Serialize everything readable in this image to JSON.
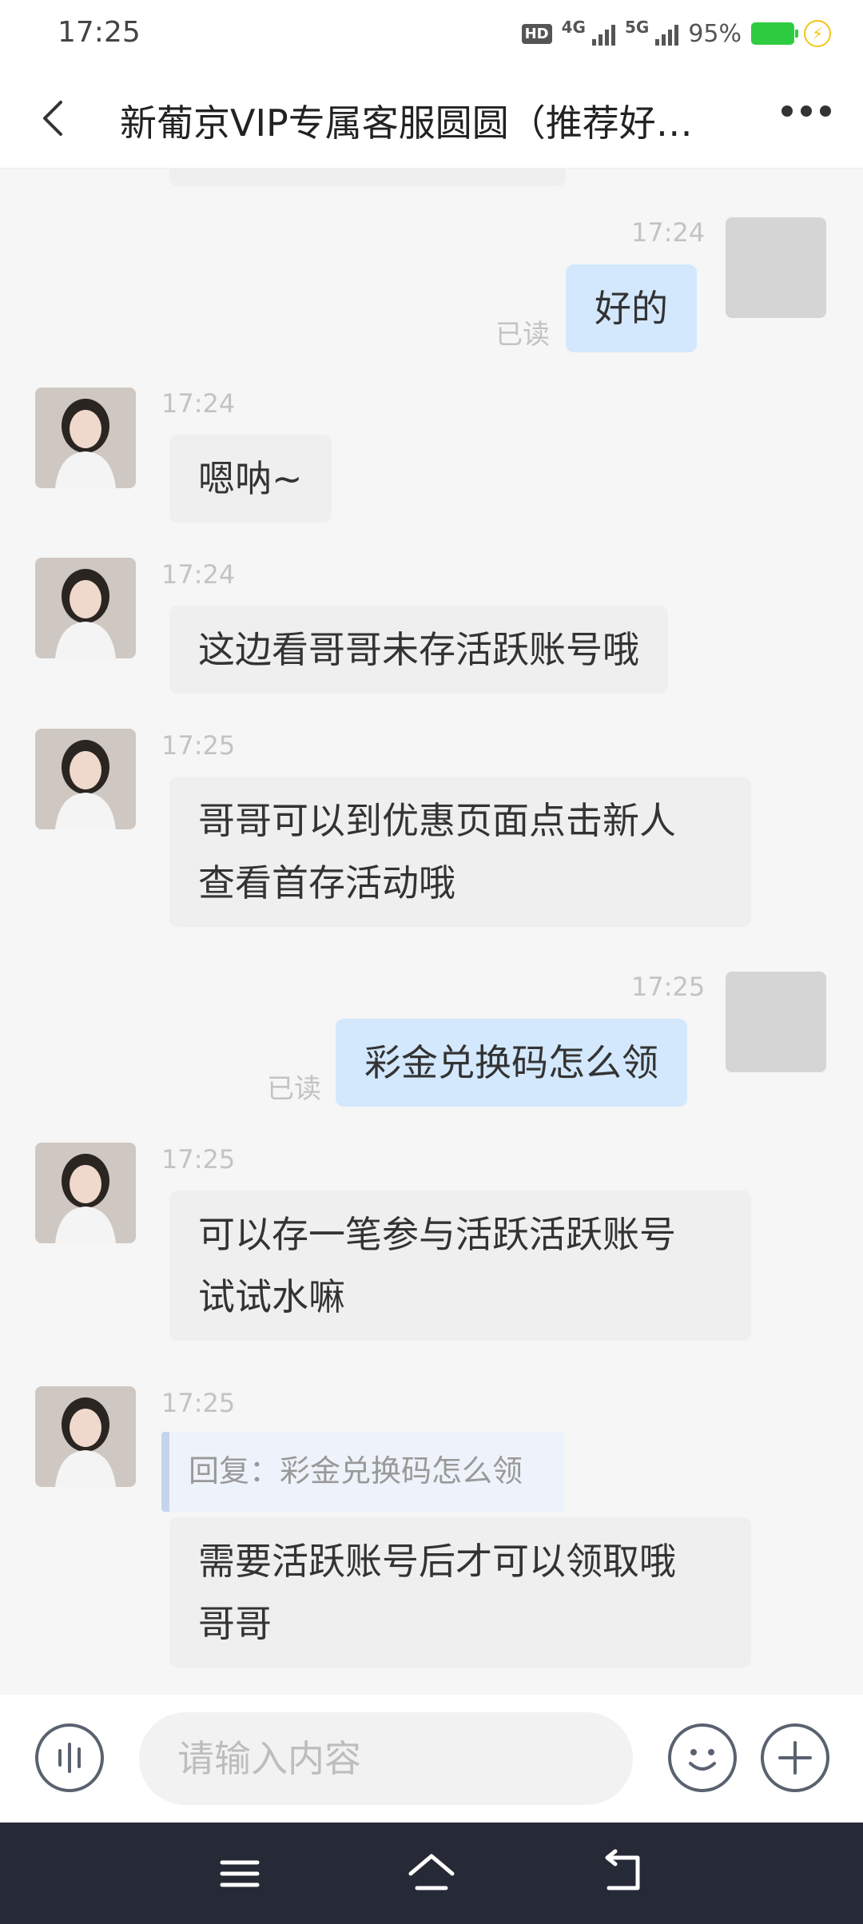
{
  "status_bar": {
    "time": "17:25",
    "hd_label": "HD",
    "network_1": "4G",
    "network_2": "5G",
    "battery_percent": "95%"
  },
  "header": {
    "title": "新葡京VIP专属客服圆圆（推荐好…"
  },
  "messages": [
    {
      "side": "out",
      "time": "17:24",
      "text": "好的",
      "status": "已读"
    },
    {
      "side": "in",
      "time": "17:24",
      "text": "嗯呐~"
    },
    {
      "side": "in",
      "time": "17:24",
      "text": "这边看哥哥未存活跃账号哦"
    },
    {
      "side": "in",
      "time": "17:25",
      "lines": [
        "哥哥可以到优惠页面点击新人",
        "查看首存活动哦"
      ]
    },
    {
      "side": "out",
      "time": "17:25",
      "text": "彩金兑换码怎么领",
      "status": "已读"
    },
    {
      "side": "in",
      "time": "17:25",
      "lines": [
        "可以存一笔参与活跃活跃账号",
        "试试水嘛"
      ]
    },
    {
      "side": "in",
      "time": "17:25",
      "reply": "回复：彩金兑换码怎么领",
      "lines": [
        "需要活跃账号后才可以领取哦",
        "哥哥"
      ]
    }
  ],
  "input": {
    "placeholder": "请输入内容"
  },
  "colors": {
    "incoming_bubble": "#efefef",
    "outgoing_bubble": "#d3e8fd",
    "system_nav": "#262a36",
    "battery": "#2ecc40"
  },
  "icons": [
    "back-arrow-icon",
    "more-icon",
    "voice-icon",
    "emoji-icon",
    "plus-icon",
    "menu-icon",
    "home-icon",
    "return-icon"
  ]
}
